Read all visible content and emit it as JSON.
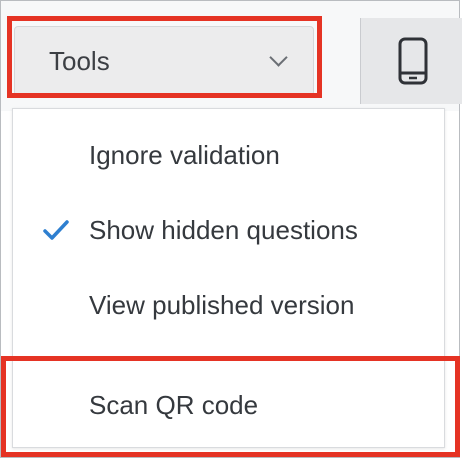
{
  "toolbar": {
    "tools_label": "Tools",
    "device_icon": "mobile-phone-icon"
  },
  "menu": {
    "items": [
      {
        "label": "Ignore validation",
        "checked": false
      },
      {
        "label": "Show hidden questions",
        "checked": true
      },
      {
        "label": "View published version",
        "checked": false
      },
      {
        "label": "Scan QR code",
        "checked": false
      }
    ]
  },
  "colors": {
    "highlight": "#e53324",
    "check": "#2e7fd0",
    "text": "#35393e"
  }
}
